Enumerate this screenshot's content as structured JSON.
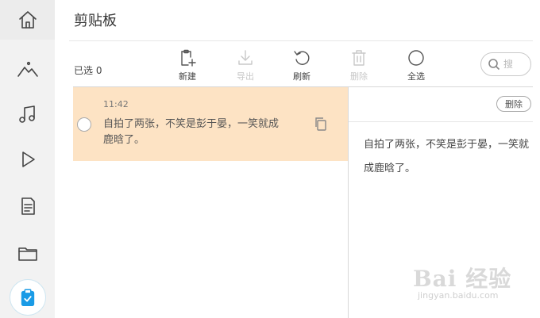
{
  "sidebar": {
    "items": [
      {
        "name": "home",
        "icon": "home-icon"
      },
      {
        "name": "photos",
        "icon": "mountain-icon"
      },
      {
        "name": "music",
        "icon": "music-note-icon"
      },
      {
        "name": "video",
        "icon": "play-icon"
      },
      {
        "name": "documents",
        "icon": "document-icon"
      },
      {
        "name": "files",
        "icon": "folder-icon"
      },
      {
        "name": "clipboard",
        "icon": "clipboard-check-icon",
        "active": true
      }
    ]
  },
  "page": {
    "title": "剪贴板"
  },
  "toolbar": {
    "selected_label": "已选 0",
    "new_label": "新建",
    "export_label": "导出",
    "refresh_label": "刷新",
    "delete_label": "删除",
    "select_all_label": "全选",
    "search_placeholder": "搜"
  },
  "clips": [
    {
      "time": "11:42",
      "text": "自拍了两张，不笑是彭于晏，一笑就成鹿晗了。",
      "selected": false
    }
  ],
  "detail": {
    "delete_label": "删除",
    "text": "自拍了两张，不笑是彭于晏，一笑就成鹿晗了。"
  },
  "watermark": {
    "text": "Bai 经验",
    "url": "jingyan.baidu.com"
  },
  "colors": {
    "highlight": "#fde3c4",
    "sidebar_bg": "#f2f2f2"
  }
}
